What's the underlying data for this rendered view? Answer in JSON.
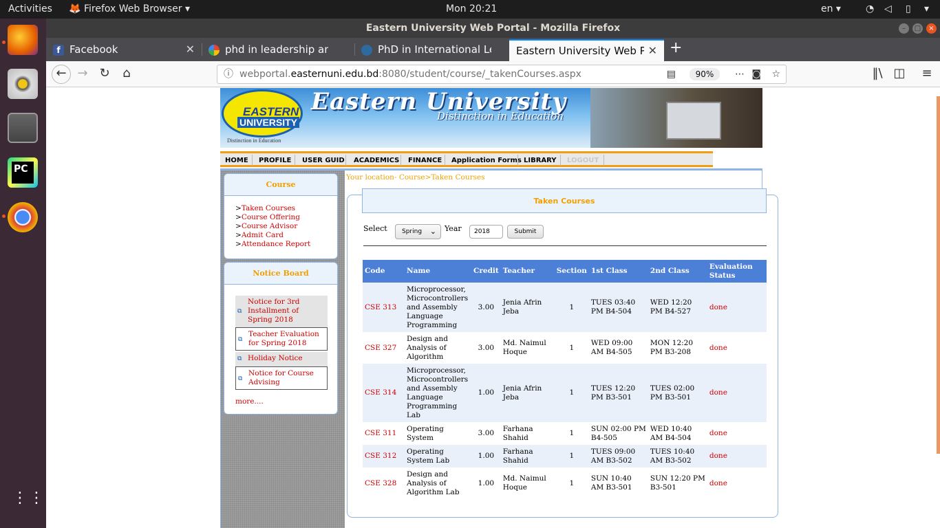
{
  "topbar": {
    "activities": "Activities",
    "app": "Firefox Web Browser ▾",
    "clock": "Mon 20:21",
    "lang": "en ▾"
  },
  "window": {
    "title": "Eastern University Web Portal - Mozilla Firefox"
  },
  "tabs": [
    {
      "label": "Facebook",
      "icon_color": "#3b5998",
      "active": false
    },
    {
      "label": "phd in leadership and ma",
      "icon_color": "#ffffff",
      "active": false
    },
    {
      "label": "PhD in International Lead",
      "icon_color": "#2d6a9f",
      "active": false
    },
    {
      "label": "Eastern University Web Port",
      "icon_color": "#ffffff",
      "active": true
    }
  ],
  "url": {
    "prefix": "webportal.",
    "host": "easternuni.edu.bd",
    "rest": ":8080/student/course/_takenCourses.aspx",
    "zoom": "90%"
  },
  "banner": {
    "logo_line1": "EASTERN",
    "logo_line2": "UNIVERSITY",
    "logo_motto": "Distinction in Education",
    "title": "Eastern University",
    "subtitle": "Distinction in Education"
  },
  "menu": [
    "HOME",
    "PROFILE",
    "USER GUID",
    "ACADEMICS",
    "FINANCE",
    "Application Forms",
    "LIBRARY",
    "LOGOUT"
  ],
  "sidebar": {
    "course_title": "Course",
    "course_links": [
      "Taken Courses",
      "Course Offering",
      "Course Advisor",
      "Admit Card",
      "Attendance Report"
    ],
    "notice_title": "Notice Board",
    "notices": [
      "Notice for 3rd Installment of Spring 2018",
      "Teacher Evaluation for Spring 2018",
      "Holiday Notice",
      "Notice for Course Advising"
    ],
    "more": "more...."
  },
  "breadcrumb": "Your location- Course>Taken Courses",
  "content": {
    "title": "Taken Courses",
    "select_label": "Select",
    "semester": "Spring",
    "year_label": "Year",
    "year": "2018",
    "submit": "Submit"
  },
  "table": {
    "headers": [
      "Code",
      "Name",
      "Credit",
      "Teacher",
      "Section",
      "1st Class",
      "2nd Class",
      "Evaluation Status"
    ],
    "rows": [
      {
        "code": "CSE 313",
        "name": "Microprocessor, Microcontrollers and Assembly Language Programming",
        "credit": "3.00",
        "teacher": "Jenia Afrin Jeba",
        "section": "1",
        "c1": "TUES 03:40 PM B4-504",
        "c2": "WED 12:20 PM B4-527",
        "status": "done"
      },
      {
        "code": "CSE 327",
        "name": "Design and Analysis of Algorithm",
        "credit": "3.00",
        "teacher": "Md. Naimul Hoque",
        "section": "1",
        "c1": "WED 09:00 AM B4-505",
        "c2": "MON 12:20 PM B3-208",
        "status": "done"
      },
      {
        "code": "CSE 314",
        "name": "Microprocessor, Microcontrollers and Assembly Language Programming Lab",
        "credit": "1.00",
        "teacher": "Jenia Afrin Jeba",
        "section": "1",
        "c1": "TUES 12:20 PM B3-501",
        "c2": "TUES 02:00 PM B3-501",
        "status": "done"
      },
      {
        "code": "CSE 311",
        "name": "Operating System",
        "credit": "3.00",
        "teacher": "Farhana Shahid",
        "section": "1",
        "c1": "SUN 02:00 PM B4-505",
        "c2": "WED 10:40 AM B4-504",
        "status": "done"
      },
      {
        "code": "CSE 312",
        "name": "Operating System Lab",
        "credit": "1.00",
        "teacher": "Farhana Shahid",
        "section": "1",
        "c1": "TUES 09:00 AM B3-502",
        "c2": "TUES 10:40 AM B3-502",
        "status": "done"
      },
      {
        "code": "CSE 328",
        "name": "Design and Analysis of Algorithm Lab",
        "credit": "1.00",
        "teacher": "Md. Naimul Hoque",
        "section": "1",
        "c1": "SUN 10:40 AM B3-501",
        "c2": "SUN 12:20 PM B3-501",
        "status": "done"
      }
    ]
  }
}
